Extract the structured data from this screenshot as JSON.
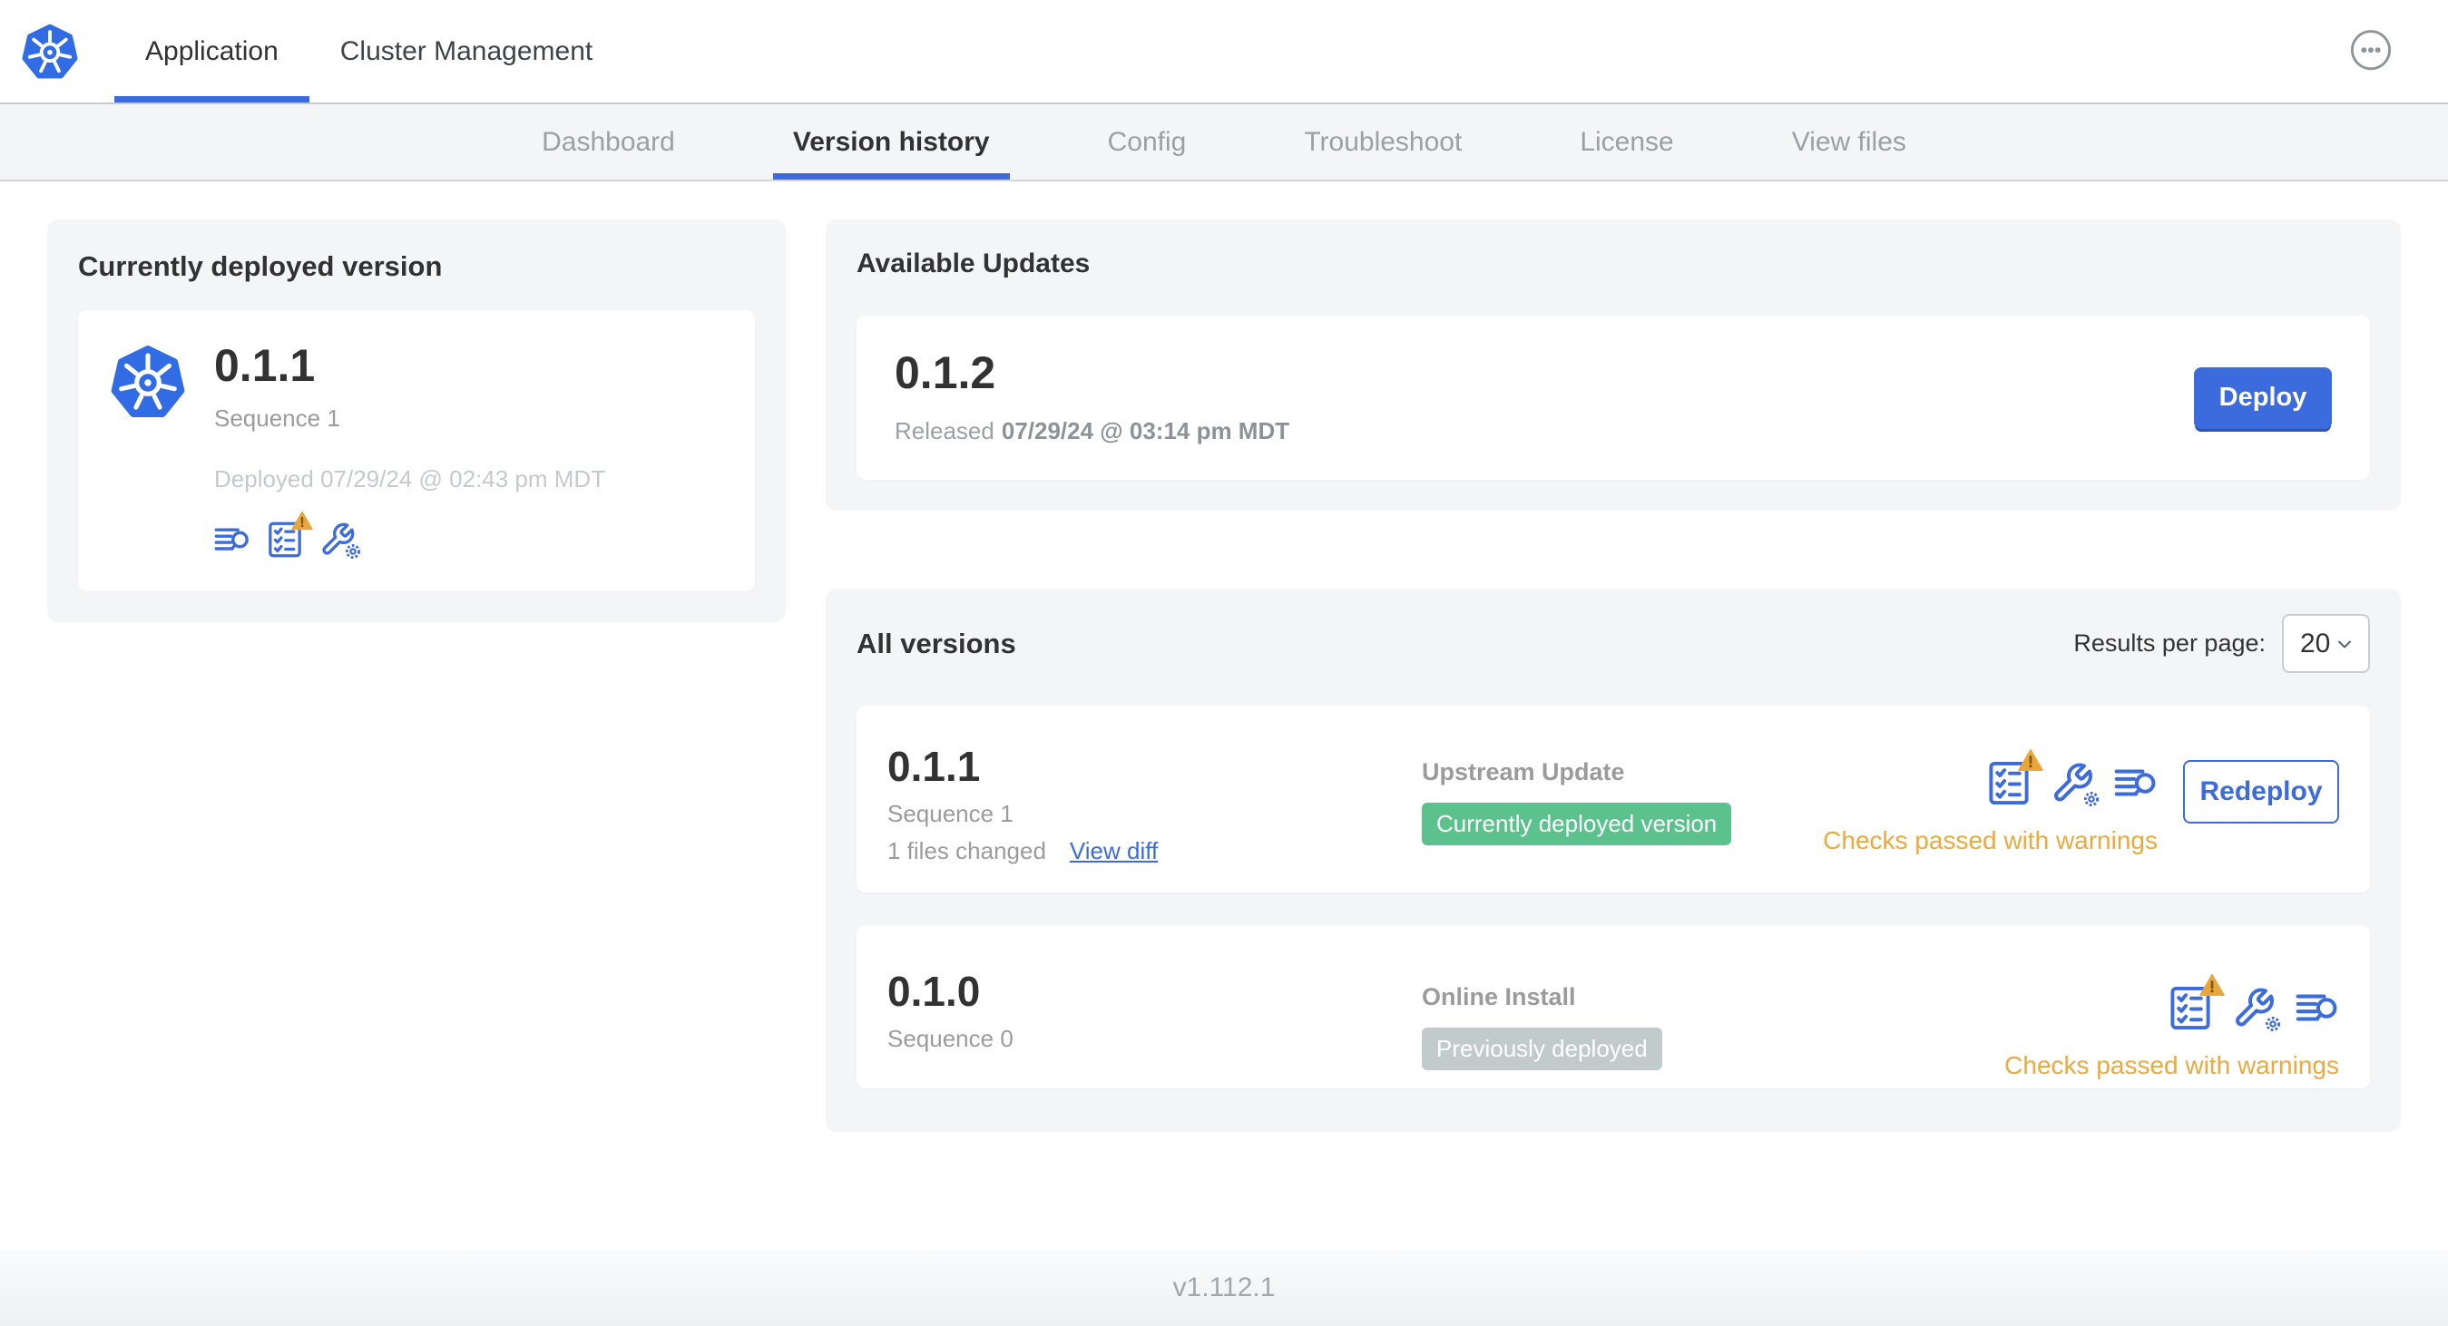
{
  "header": {
    "tabs": [
      {
        "label": "Application"
      },
      {
        "label": "Cluster Management"
      }
    ]
  },
  "subnav": {
    "tabs": [
      "Dashboard",
      "Version history",
      "Config",
      "Troubleshoot",
      "License",
      "View files"
    ]
  },
  "currently_deployed": {
    "title": "Currently deployed version",
    "version": "0.1.1",
    "sequence": "Sequence 1",
    "deployed_timestamp": "Deployed 07/29/24 @ 02:43 pm MDT"
  },
  "available_updates": {
    "title": "Available Updates",
    "version": "0.1.2",
    "released_label": "Released",
    "released_timestamp": "07/29/24 @ 03:14 pm MDT",
    "deploy_button": "Deploy"
  },
  "all_versions": {
    "title": "All versions",
    "results_per_page_label": "Results per page:",
    "results_per_page_value": "20",
    "rows": [
      {
        "version": "0.1.1",
        "sequence": "Sequence 1",
        "files_changed": "1 files changed",
        "view_diff_link": "View diff",
        "source": "Upstream Update",
        "badge": "Currently deployed version",
        "action_button": "Redeploy",
        "status": "Checks passed with warnings"
      },
      {
        "version": "0.1.0",
        "sequence": "Sequence 0",
        "source": "Online Install",
        "badge": "Previously deployed",
        "status": "Checks passed with warnings"
      }
    ]
  },
  "footer": {
    "app_version": "v1.112.1"
  },
  "icons": {
    "brand": "kubernetes-logo-icon",
    "more_menu": "ellipsis-icon",
    "logs": "logs-search-icon",
    "checks": "checklist-icon",
    "checks_warning": "warning-triangle-icon",
    "config": "wrench-gear-icon",
    "select_arrow": "chevron-down-icon"
  },
  "colors": {
    "accent_blue": "#3b6bdc",
    "kubernetes_blue": "#326ce5",
    "deployed_badge_green": "#5cc28d",
    "previous_badge_gray": "#c2cbcc",
    "warning_amber": "#eca93e",
    "warning_triangle_fill": "#e9a63b"
  }
}
